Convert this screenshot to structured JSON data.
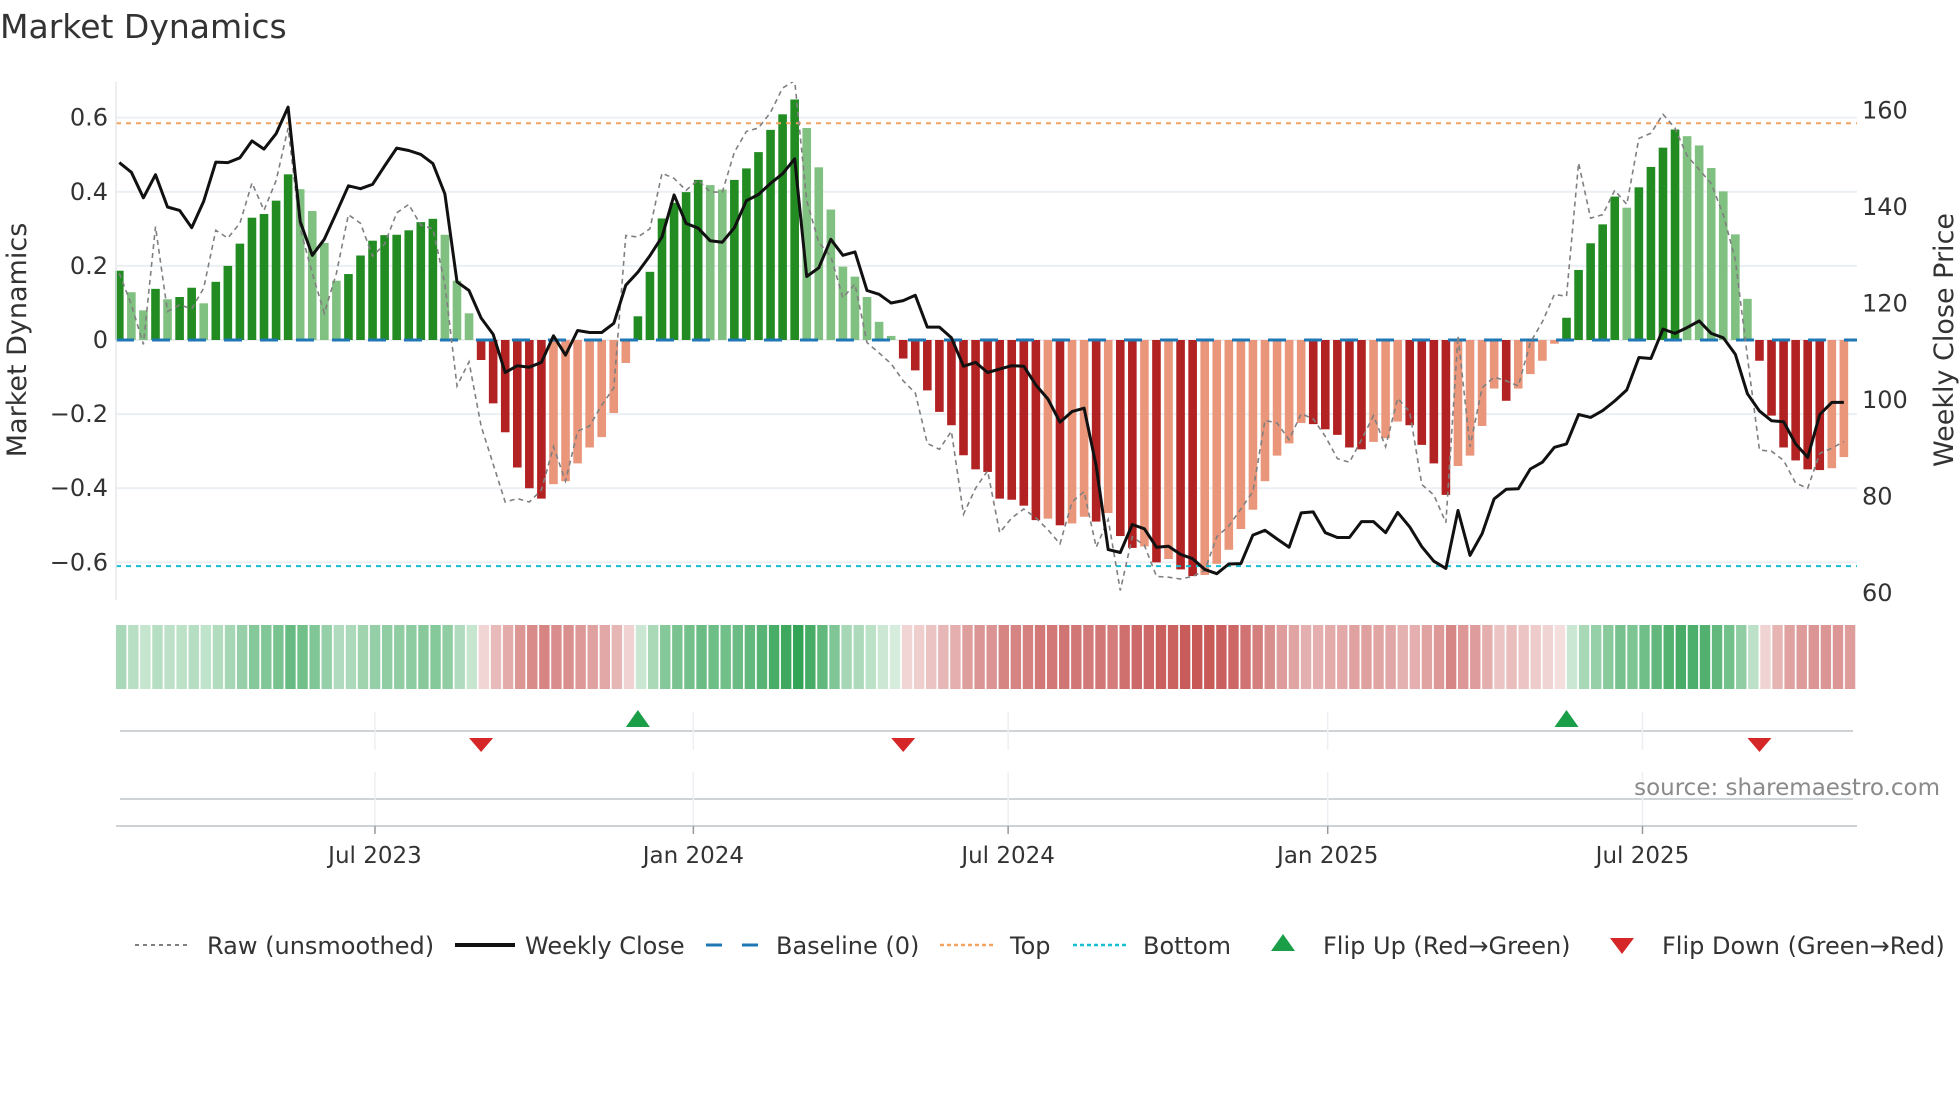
{
  "title": "Market Dynamics",
  "source": "source: sharemaestro.com",
  "chart_data": {
    "type": "bar",
    "title": "Market Dynamics",
    "ylabel": "Market Dynamics",
    "y2label": "Weekly Close Price",
    "ylim": [
      -0.7,
      0.7
    ],
    "y2lim": [
      58.5,
      165.9
    ],
    "yticks": [
      {
        "v": 0.6,
        "label": "0.6"
      },
      {
        "v": 0.4,
        "label": "0.4"
      },
      {
        "v": 0.2,
        "label": "0.2"
      },
      {
        "v": 0,
        "label": "0"
      },
      {
        "v": -0.2,
        "label": "−0.2"
      },
      {
        "v": -0.4,
        "label": "−0.4"
      },
      {
        "v": -0.6,
        "label": "−0.6"
      }
    ],
    "y2ticks": [
      {
        "v": 160,
        "label": "160"
      },
      {
        "v": 140,
        "label": "140"
      },
      {
        "v": 120,
        "label": "120"
      },
      {
        "v": 100,
        "label": "100"
      },
      {
        "v": 80,
        "label": "80"
      },
      {
        "v": 60,
        "label": "60"
      }
    ],
    "xticks": [
      {
        "week": 21.2,
        "label": "Jul 2023"
      },
      {
        "week": 47.6,
        "label": "Jan 2024"
      },
      {
        "week": 73.7,
        "label": "Jul 2024"
      },
      {
        "week": 100.2,
        "label": "Jan 2025"
      },
      {
        "week": 126.3,
        "label": "Jul 2025"
      }
    ],
    "top_level": 0.585,
    "bottom_level": -0.61,
    "baseline": 0,
    "series": [
      {
        "name": "Market Dynamics (smoothed)",
        "values": [
          0.187,
          0.129,
          0.08,
          0.138,
          0.11,
          0.116,
          0.141,
          0.099,
          0.157,
          0.2,
          0.26,
          0.33,
          0.34,
          0.376,
          0.447,
          0.407,
          0.348,
          0.262,
          0.16,
          0.178,
          0.228,
          0.268,
          0.283,
          0.284,
          0.296,
          0.318,
          0.327,
          0.284,
          0.16,
          0.072,
          -0.054,
          -0.171,
          -0.249,
          -0.344,
          -0.4,
          -0.428,
          -0.389,
          -0.381,
          -0.333,
          -0.29,
          -0.262,
          -0.197,
          -0.062,
          0.064,
          0.184,
          0.328,
          0.37,
          0.399,
          0.432,
          0.418,
          0.406,
          0.432,
          0.463,
          0.507,
          0.567,
          0.609,
          0.649,
          0.572,
          0.466,
          0.352,
          0.198,
          0.171,
          0.116,
          0.049,
          0.011,
          -0.05,
          -0.082,
          -0.136,
          -0.194,
          -0.23,
          -0.311,
          -0.349,
          -0.356,
          -0.428,
          -0.431,
          -0.447,
          -0.486,
          -0.482,
          -0.5,
          -0.495,
          -0.477,
          -0.49,
          -0.467,
          -0.529,
          -0.561,
          -0.557,
          -0.6,
          -0.591,
          -0.619,
          -0.637,
          -0.634,
          -0.604,
          -0.566,
          -0.51,
          -0.458,
          -0.381,
          -0.312,
          -0.279,
          -0.224,
          -0.227,
          -0.241,
          -0.256,
          -0.29,
          -0.295,
          -0.275,
          -0.265,
          -0.22,
          -0.23,
          -0.283,
          -0.333,
          -0.418,
          -0.34,
          -0.312,
          -0.232,
          -0.131,
          -0.164,
          -0.131,
          -0.092,
          -0.056,
          -0.01,
          0.06,
          0.189,
          0.261,
          0.312,
          0.387,
          0.357,
          0.412,
          0.467,
          0.519,
          0.568,
          0.55,
          0.525,
          0.464,
          0.401,
          0.285,
          0.111,
          -0.056,
          -0.204,
          -0.29,
          -0.325,
          -0.349,
          -0.351,
          -0.346,
          -0.316
        ]
      },
      {
        "name": "Raw (unsmoothed)",
        "values": [
          0.18,
          0.095,
          -0.012,
          0.306,
          0.077,
          0.095,
          0.084,
          0.14,
          0.296,
          0.275,
          0.315,
          0.424,
          0.35,
          0.43,
          0.572,
          0.3,
          0.18,
          0.072,
          0.18,
          0.338,
          0.315,
          0.226,
          0.259,
          0.343,
          0.366,
          0.31,
          0.3,
          0.151,
          -0.124,
          -0.059,
          -0.232,
          -0.335,
          -0.437,
          -0.428,
          -0.437,
          -0.405,
          -0.288,
          -0.381,
          -0.246,
          -0.232,
          -0.176,
          -0.129,
          0.282,
          0.278,
          0.3,
          0.45,
          0.436,
          0.404,
          0.432,
          0.399,
          0.399,
          0.507,
          0.563,
          0.572,
          0.614,
          0.68,
          0.7,
          0.376,
          0.263,
          0.226,
          0.114,
          0.151,
          -0.007,
          -0.035,
          -0.064,
          -0.11,
          -0.143,
          -0.279,
          -0.295,
          -0.246,
          -0.47,
          -0.4,
          -0.353,
          -0.52,
          -0.48,
          -0.456,
          -0.48,
          -0.512,
          -0.55,
          -0.437,
          -0.409,
          -0.559,
          -0.484,
          -0.676,
          -0.531,
          -0.554,
          -0.638,
          -0.64,
          -0.645,
          -0.638,
          -0.622,
          -0.531,
          -0.502,
          -0.456,
          -0.409,
          -0.217,
          -0.224,
          -0.269,
          -0.199,
          -0.213,
          -0.26,
          -0.32,
          -0.33,
          -0.269,
          -0.204,
          -0.288,
          -0.157,
          -0.194,
          -0.39,
          -0.418,
          -0.493,
          0.011,
          -0.288,
          -0.129,
          -0.1,
          -0.11,
          -0.124,
          -0.007,
          0.049,
          0.123,
          0.118,
          0.478,
          0.329,
          0.338,
          0.404,
          0.366,
          0.544,
          0.558,
          0.609,
          0.572,
          0.497,
          0.46,
          0.422,
          0.338,
          0.217,
          -0.045,
          -0.297,
          -0.3,
          -0.325,
          -0.386,
          -0.4,
          -0.306,
          -0.292,
          -0.274
        ]
      },
      {
        "name": "Weekly Close",
        "axis": "right",
        "values": [
          149.2,
          147.2,
          141.9,
          146.7,
          140.0,
          139.3,
          135.7,
          141.2,
          149.3,
          149.2,
          150.2,
          153.7,
          152.0,
          155.2,
          160.7,
          137.0,
          130.0,
          133.3,
          138.8,
          144.4,
          143.8,
          144.7,
          148.5,
          152.2,
          151.7,
          150.9,
          149.0,
          142.7,
          124.5,
          122.7,
          117.0,
          113.6,
          105.7,
          107.1,
          106.8,
          107.8,
          113.3,
          109.3,
          114.4,
          114.0,
          114.0,
          115.9,
          123.8,
          126.5,
          129.9,
          133.8,
          142.5,
          136.6,
          135.6,
          133.0,
          132.7,
          135.7,
          141.3,
          142.6,
          144.9,
          146.9,
          150.0,
          125.6,
          127.4,
          133.3,
          130.0,
          130.7,
          122.7,
          121.9,
          120.1,
          120.6,
          121.7,
          115.1,
          115.1,
          112.9,
          107.0,
          107.8,
          105.7,
          106.4,
          107.1,
          107.0,
          103.1,
          100.2,
          95.4,
          97.6,
          98.3,
          86.3,
          69.0,
          68.4,
          74.2,
          73.3,
          69.5,
          69.7,
          68.0,
          67.1,
          64.9,
          64.0,
          66.0,
          66.1,
          72.0,
          73.0,
          71.2,
          69.5,
          76.6,
          76.8,
          72.5,
          71.5,
          71.5,
          74.8,
          74.8,
          72.5,
          76.7,
          73.7,
          69.6,
          66.6,
          65.1,
          77.1,
          67.8,
          72.3,
          79.5,
          81.5,
          81.6,
          85.7,
          87.1,
          90.2,
          90.9,
          97.0,
          96.4,
          97.8,
          99.8,
          102.1,
          108.8,
          108.6,
          114.7,
          113.8,
          115.0,
          116.4,
          113.8,
          112.9,
          109.5,
          101.3,
          97.7,
          95.7,
          95.5,
          90.9,
          88.1,
          97.0,
          99.5,
          99.5
        ]
      }
    ],
    "flips": [
      {
        "week": 31,
        "type": "down"
      },
      {
        "week": 44,
        "type": "up"
      },
      {
        "week": 66,
        "type": "down"
      },
      {
        "week": 121,
        "type": "up"
      },
      {
        "week": 137,
        "type": "down"
      }
    ],
    "legend": {
      "placement": "bottom",
      "items": [
        {
          "label": "Raw (unsmoothed)",
          "kind": "raw"
        },
        {
          "label": "Weekly Close",
          "kind": "close"
        },
        {
          "label": "Baseline (0)",
          "kind": "baseline"
        },
        {
          "label": "Top",
          "kind": "top"
        },
        {
          "label": "Bottom",
          "kind": "bottom"
        },
        {
          "label": "Flip Up (Red→Green)",
          "kind": "up"
        },
        {
          "label": "Flip Down (Green→Red)",
          "kind": "down"
        }
      ]
    },
    "colors": {
      "green_strong": "#228b22",
      "green_weak": "#80c080",
      "red_strong": "#b22222",
      "red_weak": "#e9967a",
      "top": "#f4a460",
      "bottom": "#17becf",
      "baseline": "#1f77b4",
      "raw": "#808080",
      "close": "#111111",
      "flip_up": "#1a9e48",
      "flip_down": "#d62728"
    }
  }
}
